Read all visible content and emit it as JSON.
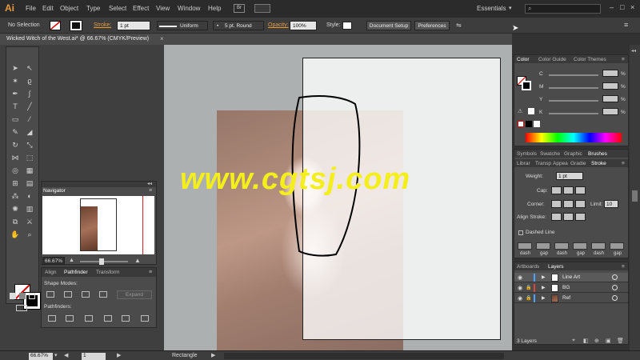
{
  "menubar": {
    "logo": "Ai",
    "items": [
      "File",
      "Edit",
      "Object",
      "Type",
      "Select",
      "Effect",
      "View",
      "Window",
      "Help"
    ],
    "br": "Br",
    "workspace": "Essentials",
    "window_controls": [
      "–",
      "□",
      "×"
    ]
  },
  "control": {
    "selection": "No Selection",
    "stroke_label": "Stroke:",
    "stroke_weight": "1 pt",
    "profile": "Uniform",
    "brush": "5 pt. Round",
    "opacity_label": "Opacity:",
    "opacity": "100%",
    "style_label": "Style:",
    "document_setup": "Document Setup",
    "preferences": "Preferences"
  },
  "document": {
    "title": "Wicked Witch of the West.ai* @ 66.67% (CMYK/Preview)",
    "close": "×"
  },
  "watermark": "www.cgtsj.com",
  "navigator": {
    "tab": "Navigator",
    "zoom": "66.67%"
  },
  "pathfinder": {
    "tabs": [
      "Align",
      "Pathfinder",
      "Transform"
    ],
    "shape_modes": "Shape Modes:",
    "pathfinders": "Pathfinders:",
    "expand": "Expand"
  },
  "color_panel": {
    "tabs": [
      "Color",
      "Color Guide",
      "Color Themes"
    ],
    "channels": [
      {
        "label": "C",
        "unit": "%"
      },
      {
        "label": "M",
        "unit": "%"
      },
      {
        "label": "Y",
        "unit": "%"
      },
      {
        "label": "K",
        "unit": "%"
      }
    ]
  },
  "library_tabs": [
    "Symbols",
    "Swatche",
    "Graphic",
    "Brushes"
  ],
  "stroke_tabs": [
    "Librar",
    "Transp",
    "Appea",
    "Gradie",
    "Stroke"
  ],
  "stroke_panel": {
    "weight_label": "Weight:",
    "weight": "1 pt",
    "cap_label": "Cap:",
    "corner_label": "Corner:",
    "limit_label": "Limit:",
    "limit": "10",
    "align_label": "Align Stroke:",
    "dashed_label": "Dashed Line",
    "dash_labels": [
      "dash",
      "gap",
      "dash",
      "gap",
      "dash",
      "gap"
    ]
  },
  "layers_panel": {
    "tabs": [
      "Artboards",
      "Layers"
    ],
    "layers": [
      {
        "name": "Line Art",
        "color": "#4aa3ff"
      },
      {
        "name": "BG",
        "color": "#e0463a"
      },
      {
        "name": "Ref",
        "color": "#4aa3ff"
      }
    ],
    "count": "3 Layers"
  },
  "statusbar": {
    "zoom": "66.67%",
    "artboard": "1",
    "tool": "Rectangle"
  }
}
